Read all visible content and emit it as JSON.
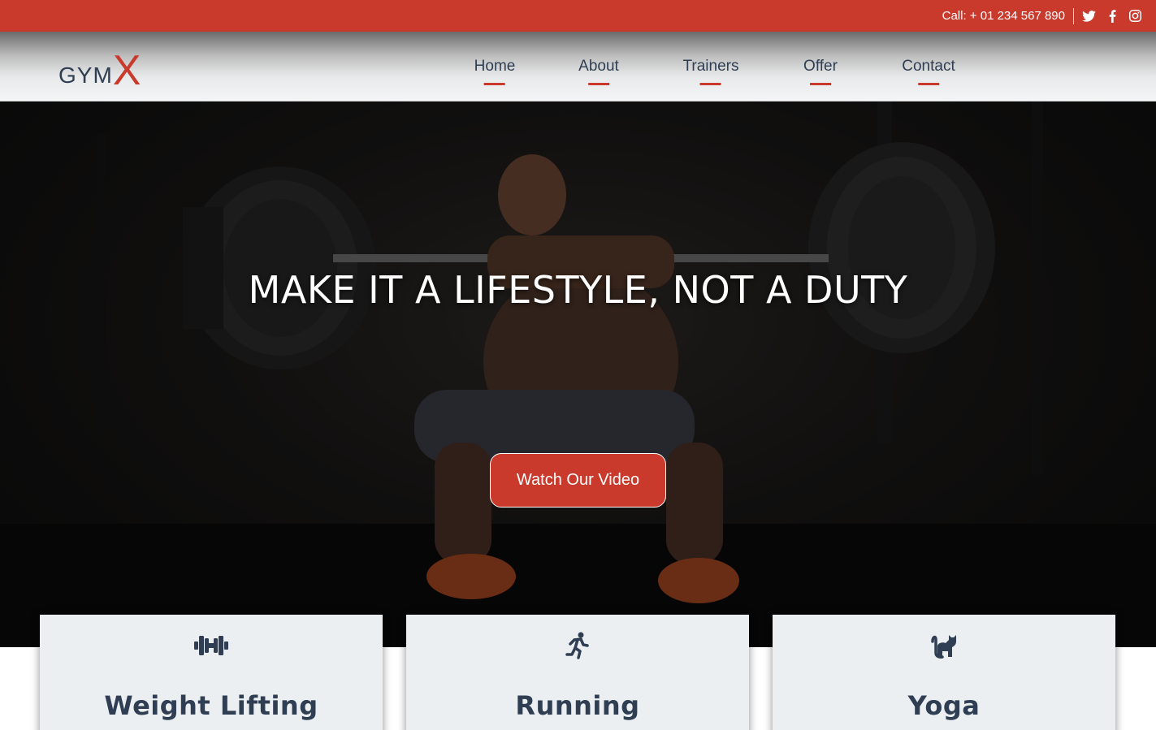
{
  "topbar": {
    "call": "Call: + 01 234 567 890",
    "social": [
      "twitter-icon",
      "facebook-icon",
      "instagram-icon"
    ]
  },
  "brand": {
    "gym": "GYM",
    "x": "X"
  },
  "nav": {
    "items": [
      {
        "label": "Home"
      },
      {
        "label": "About"
      },
      {
        "label": "Trainers"
      },
      {
        "label": "Offer"
      },
      {
        "label": "Contact"
      }
    ]
  },
  "hero": {
    "title": "MAKE IT A LIFESTYLE, NOT A DUTY",
    "button": "Watch Our Video"
  },
  "cards": [
    {
      "label": "Weight Lifting",
      "icon": "dumbbell-icon"
    },
    {
      "label": "Running",
      "icon": "running-icon"
    },
    {
      "label": "Yoga",
      "icon": "cat-icon"
    }
  ],
  "colors": {
    "accent": "#c93a2d",
    "text_dark": "#2f3e52",
    "card_bg": "#eceff1"
  }
}
